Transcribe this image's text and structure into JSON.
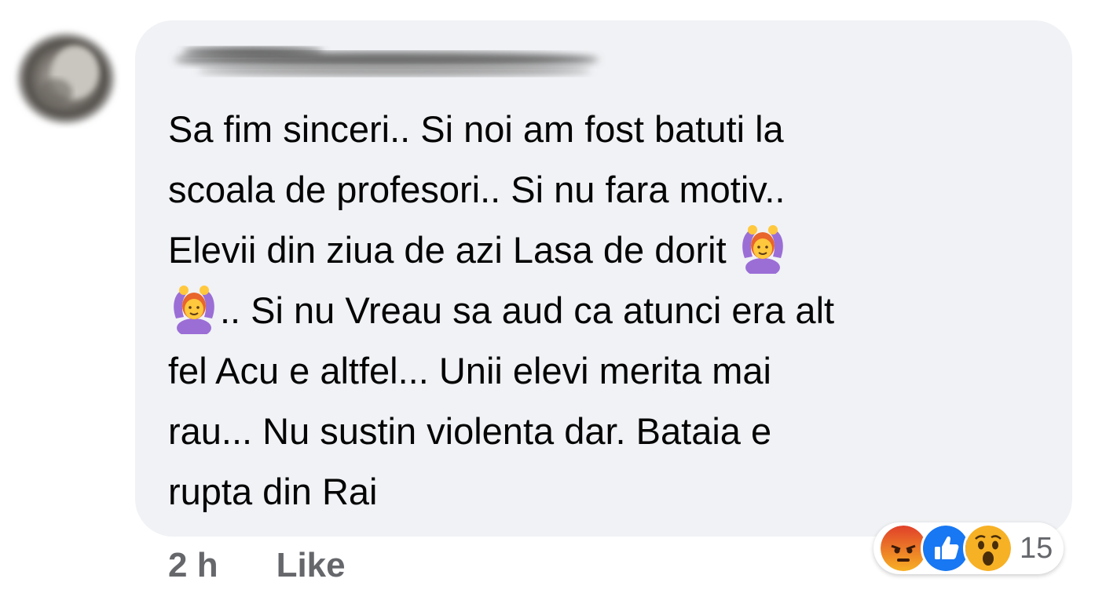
{
  "comment": {
    "lines": [
      "Sa fim sinceri.. Si noi am fost batuti la",
      "scoala de profesori.. Si nu fara motiv..",
      "Elevii din ziua de azi Lasa de dorit",
      ".. Si nu Vreau sa aud ca atunci era alt",
      "fel Acu e altfel... Unii elevi merita mai",
      "rau... Nu sustin violenta dar. Bataia e",
      "rupta din Rai"
    ],
    "emoji_icon": "person-gesturing-ok-emoji"
  },
  "meta": {
    "time": "2 h",
    "like_label": "Like"
  },
  "reactions": {
    "icons": [
      "angry-reaction-icon",
      "like-reaction-icon",
      "wow-reaction-icon"
    ],
    "count": "15"
  },
  "colors": {
    "bubble": "#f0f2f5",
    "text": "#050505",
    "meta": "#65676b",
    "like_blue": "#1877f2",
    "angry_red": "#e9710f",
    "wow_yellow": "#f7b125"
  }
}
